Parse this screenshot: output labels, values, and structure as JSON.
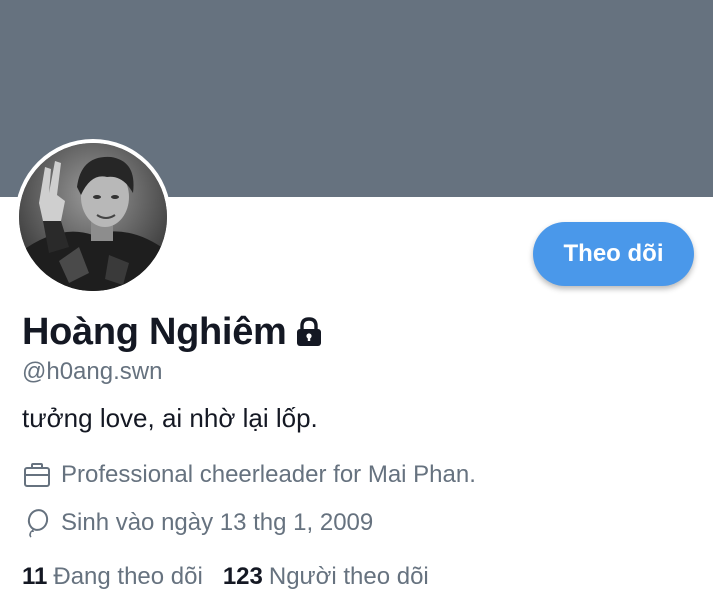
{
  "profile": {
    "display_name": "Hoàng Nghiêm",
    "handle": "@h0ang.swn",
    "bio": "tưởng love, ai nhờ lại lốp.",
    "job": "Professional cheerleader for Mai Phan.",
    "birthday": "Sinh vào ngày 13 thg 1, 2009",
    "protected": true
  },
  "actions": {
    "follow_label": "Theo dõi"
  },
  "stats": {
    "following_count": "11",
    "following_label": "Đang theo dõi",
    "followers_count": "123",
    "followers_label": "Người theo dõi"
  },
  "icons": {
    "lock": "lock-icon",
    "job": "briefcase-icon",
    "birthday": "balloon-icon"
  },
  "colors": {
    "banner": "#66727f",
    "accent": "#4a98ea",
    "text_primary": "#141823",
    "text_secondary": "#66727f"
  }
}
